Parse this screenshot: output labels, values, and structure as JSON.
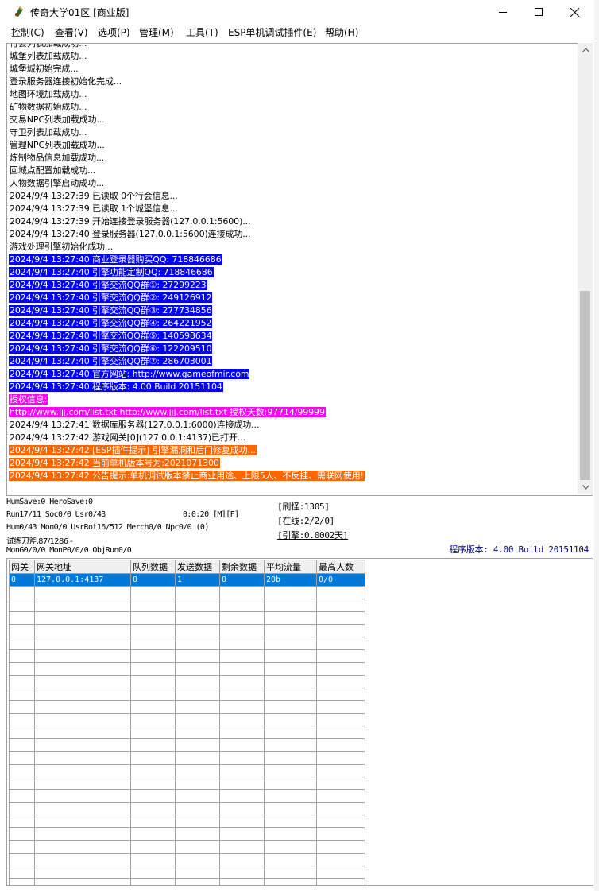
{
  "window": {
    "title": "传奇大学01区 [商业版]",
    "minimize_glyph": "minimize-icon",
    "maximize_glyph": "maximize-icon",
    "close_glyph": "close-icon"
  },
  "menu": [
    "控制(C)",
    "查看(V)",
    "选项(P)",
    "管理(M)",
    "工具(T)",
    "ESP单机调试插件(E)",
    "帮助(H)"
  ],
  "log": {
    "lines": [
      {
        "text": "行会列表加载成功...",
        "style": "normal"
      },
      {
        "text": "城堡列表加载成功...",
        "style": "normal"
      },
      {
        "text": "城堡城初始完成...",
        "style": "normal"
      },
      {
        "text": "登录服务器连接初始化完成...",
        "style": "normal"
      },
      {
        "text": "地图环境加载成功...",
        "style": "normal"
      },
      {
        "text": "矿物数据初始成功...",
        "style": "normal"
      },
      {
        "text": "交易NPC列表加载成功...",
        "style": "normal"
      },
      {
        "text": "守卫列表加载成功...",
        "style": "normal"
      },
      {
        "text": "管理NPC列表加载成功...",
        "style": "normal"
      },
      {
        "text": "炼制物品信息加载成功...",
        "style": "normal"
      },
      {
        "text": "回城点配置加载成功...",
        "style": "normal"
      },
      {
        "text": "人物数据引擎启动成功...",
        "style": "normal"
      },
      {
        "text": "2024/9/4 13:27:39 已读取 0个行会信息...",
        "style": "normal"
      },
      {
        "text": "2024/9/4 13:27:39 已读取 1个城堡信息...",
        "style": "normal"
      },
      {
        "text": "2024/9/4 13:27:39 开始连接登录服务器(127.0.0.1:5600)...",
        "style": "normal"
      },
      {
        "text": "2024/9/4 13:27:40 登录服务器(127.0.0.1:5600)连接成功...",
        "style": "normal"
      },
      {
        "text": "游戏处理引擎初始化成功...",
        "style": "normal"
      },
      {
        "text": "2024/9/4 13:27:40 商业登录器购买QQ: 718846686",
        "style": "blue"
      },
      {
        "text": "2024/9/4 13:27:40 引擎功能定制QQ: 718846686",
        "style": "blue"
      },
      {
        "text": "2024/9/4 13:27:40 引擎交流QQ群①: 27299223",
        "style": "blue"
      },
      {
        "text": "2024/9/4 13:27:40 引擎交流QQ群②: 249126912",
        "style": "blue"
      },
      {
        "text": "2024/9/4 13:27:40 引擎交流QQ群③: 277734856",
        "style": "blue"
      },
      {
        "text": "2024/9/4 13:27:40 引擎交流QQ群④: 264221952",
        "style": "blue"
      },
      {
        "text": "2024/9/4 13:27:40 引擎交流QQ群⑤: 140598634",
        "style": "blue"
      },
      {
        "text": "2024/9/4 13:27:40 引擎交流QQ群⑥: 122209510",
        "style": "blue"
      },
      {
        "text": "2024/9/4 13:27:40 引擎交流QQ群⑦: 286703001",
        "style": "blue"
      },
      {
        "text": "2024/9/4 13:27:40 官方网站: http://www.gameofmir.com",
        "style": "blue"
      },
      {
        "text": "2024/9/4 13:27:40 程序版本: 4.00 Build 20151104",
        "style": "blue"
      },
      {
        "text": "授权信息:",
        "style": "magenta"
      },
      {
        "text": "http://www.jjj.com/list.txt http://www.jjj.com/list.txt 授权天数:97714/99999",
        "style": "magenta"
      },
      {
        "text": "2024/9/4 13:27:41 数据库服务器(127.0.0.1:6000)连接成功...",
        "style": "normal"
      },
      {
        "text": "2024/9/4 13:27:42 游戏网关[0](127.0.0.1:4137)已打开...",
        "style": "normal"
      },
      {
        "text": "2024/9/4 13:27:42 [ESP插件提示] 引擎漏洞和后门修复成功...",
        "style": "orange"
      },
      {
        "text": "2024/9/4 13:27:42 当前单机版本号为:2021071300",
        "style": "orange"
      },
      {
        "text": "2024/9/4 13:27:42 公告提示:单机调试版本禁止商业用途、上限5人、不反挂、需联网使用!",
        "style": "orange"
      }
    ]
  },
  "status": {
    "line1": "HumSave:0 HeroSave:0",
    "line2": "Run17/11 Soc0/0 Usr0/43",
    "time": "0:0:20 [M][F]",
    "line3": "Hum0/43 Mon0/0 UsrRot16/512 Merch0/0 Npc0/0 (0)",
    "line4": "试练刀斧,87/1286 -",
    "line5": "MonG0/0/0 MonP0/0/0 ObjRun0/0",
    "refresh": "[刷怪:1305]",
    "online": "[在线:2/2/0]",
    "engine": "[引擎:0.0002天]",
    "version": "程序版本: 4.00 Build 20151104"
  },
  "grid": {
    "headers": [
      "网关",
      "网关地址",
      "队列数据",
      "发送数据",
      "剩余数据",
      "平均流量",
      "最高人数"
    ],
    "rows": [
      [
        "0",
        "127.0.0.1:4137",
        "0",
        "1",
        "0",
        "20b",
        "0/0"
      ]
    ],
    "empty_rows": 24
  }
}
